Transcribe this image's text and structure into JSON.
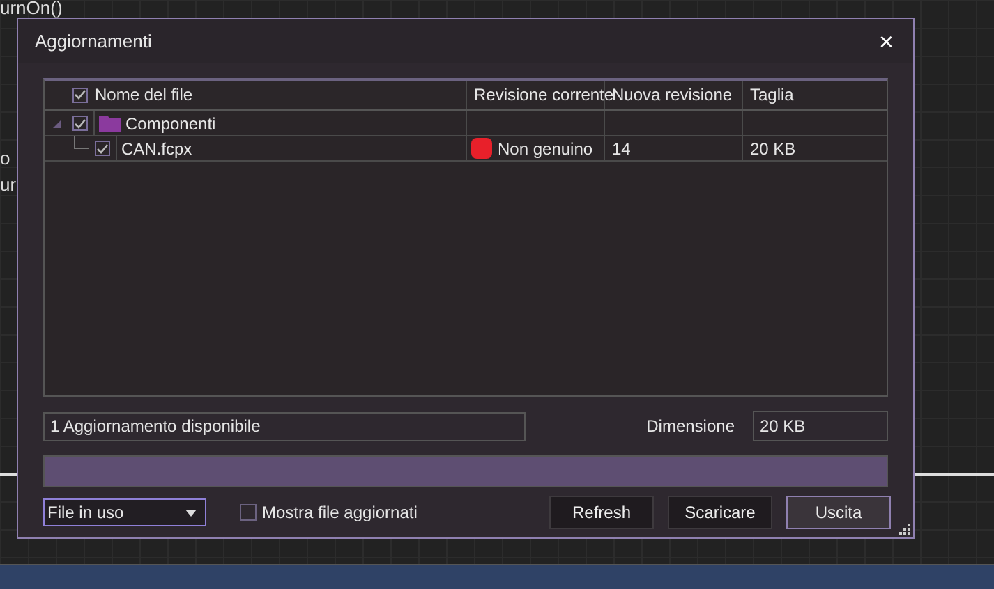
{
  "background": {
    "code_lines": [
      "urnOn()",
      "o",
      "ur"
    ]
  },
  "window": {
    "title": "Aggiornamenti",
    "close": "×"
  },
  "table": {
    "header_checked": true,
    "columns": [
      "Nome del file",
      "Revisione corrente",
      "Nuova revisione",
      "Taglia"
    ],
    "rows": [
      {
        "name": "Componenti",
        "checked": true,
        "expanded": true,
        "kind": "folder",
        "children": [
          {
            "name": "CAN.fcpx",
            "checked": true,
            "color": "#e8202a",
            "current_revision": "Non genuino",
            "new_revision": "14",
            "size": "20 KB"
          }
        ]
      }
    ]
  },
  "status": "1 Aggiornamento disponibile",
  "size_label": "Dimensione",
  "size_value": "20 KB",
  "progress": {
    "level": 1
  },
  "filter": {
    "value": "File in uso"
  },
  "show_updated": {
    "label": "Mostra file aggiornati",
    "checked": false
  },
  "buttons": [
    {
      "label": "Refresh",
      "selected": false
    },
    {
      "label": "Scaricare",
      "selected": false
    },
    {
      "label": "Uscita",
      "selected": true
    }
  ]
}
